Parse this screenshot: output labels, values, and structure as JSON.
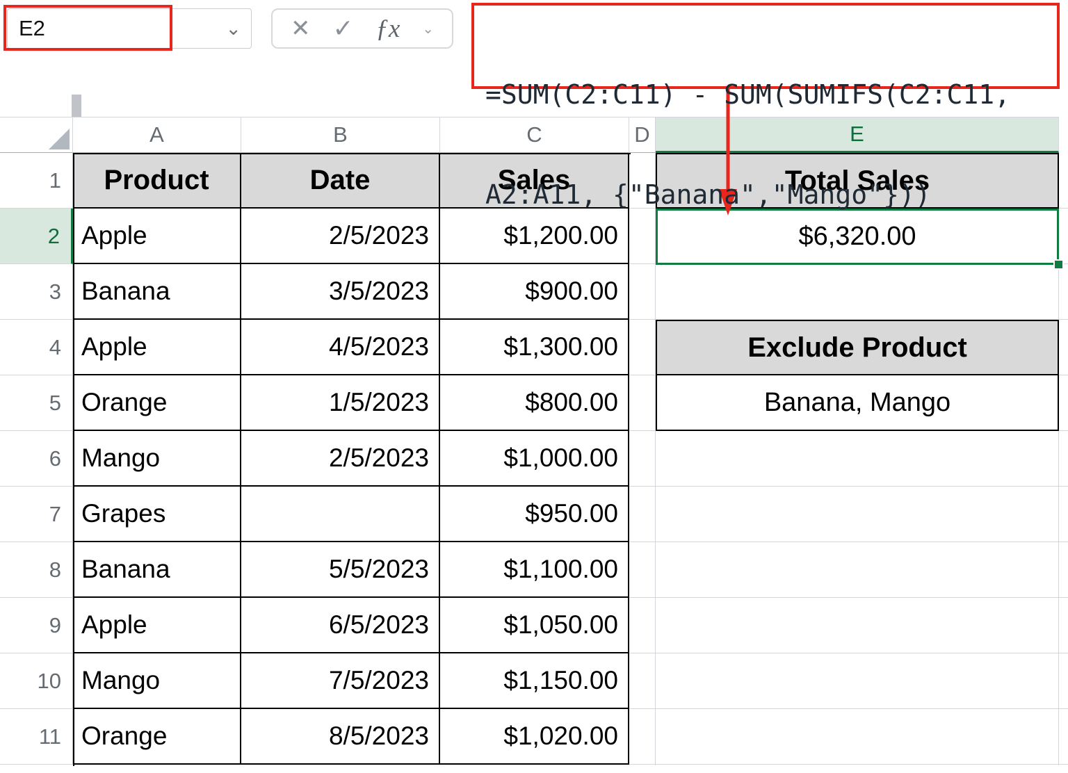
{
  "formula_bar": {
    "name_box_value": "E2",
    "dropdown_icon": "⌄",
    "cancel_icon": "✕",
    "confirm_icon": "✓",
    "fx_icon": "ƒx",
    "fx_dropdown_icon": "⌄",
    "formula_line1": "=SUM(C2:C11) - SUM(SUMIFS(C2:C11,",
    "formula_line2": "A2:A11, {\"Banana\",\"Mango\"}))"
  },
  "sheet": {
    "column_headers": [
      "A",
      "B",
      "C",
      "D",
      "E"
    ],
    "row_headers": [
      "1",
      "2",
      "3",
      "4",
      "5",
      "6",
      "7",
      "8",
      "9",
      "10",
      "11"
    ],
    "selected_cell_ref": "E2",
    "table": {
      "headers": {
        "product": "Product",
        "date": "Date",
        "sales": "Sales"
      },
      "rows": [
        {
          "product": "Apple",
          "date": "2/5/2023",
          "sales": "$1,200.00"
        },
        {
          "product": "Banana",
          "date": "3/5/2023",
          "sales": "$900.00"
        },
        {
          "product": "Apple",
          "date": "4/5/2023",
          "sales": "$1,300.00"
        },
        {
          "product": "Orange",
          "date": "1/5/2023",
          "sales": "$800.00"
        },
        {
          "product": "Mango",
          "date": "2/5/2023",
          "sales": "$1,000.00"
        },
        {
          "product": "Grapes",
          "date": "",
          "sales": "$950.00"
        },
        {
          "product": "Banana",
          "date": "5/5/2023",
          "sales": "$1,100.00"
        },
        {
          "product": "Apple",
          "date": "6/5/2023",
          "sales": "$1,050.00"
        },
        {
          "product": "Mango",
          "date": "7/5/2023",
          "sales": "$1,150.00"
        },
        {
          "product": "Orange",
          "date": "8/5/2023",
          "sales": "$1,020.00"
        }
      ]
    },
    "summary": {
      "total_sales_label": "Total Sales",
      "total_sales_value": "$6,320.00",
      "exclude_label": "Exclude Product",
      "exclude_value": "Banana, Mango"
    }
  },
  "colors": {
    "annotation_red": "#e8261d",
    "selection_green": "#107c41",
    "table_header_fill": "#d9d9d9",
    "selected_header_fill": "#d9e8df"
  }
}
